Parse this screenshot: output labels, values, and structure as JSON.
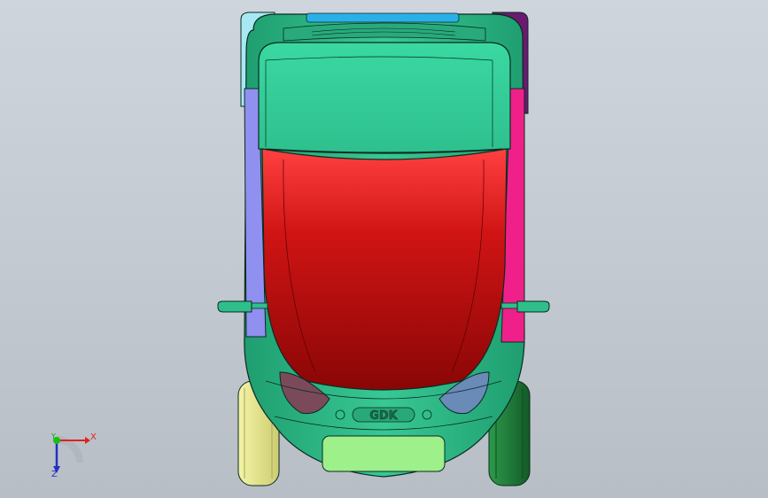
{
  "viewport": {
    "background_top": "#cfd5dc",
    "background_bottom": "#b8bec5"
  },
  "model": {
    "badge_text": "GDK",
    "colors": {
      "body_green": "#2fbf8a",
      "roof_green": "#3fd6a0",
      "hood_red": "#c01010",
      "left_panel": "#9090f0",
      "right_panel": "#f0208a",
      "front_left_wheel": "#e8e890",
      "front_right_wheel": "#1f7a3a",
      "rear_left_trim": "#a8e8f4",
      "rear_right_trim": "#6a1a70",
      "plate": "#9ef08a",
      "top_strip": "#2ab0e8",
      "outline": "#0b2a20"
    }
  },
  "triad": {
    "x_label": "X",
    "y_label": "Y",
    "z_label": "Z",
    "x_color": "#e02020",
    "y_color": "#16a016",
    "z_color": "#2030c8"
  }
}
